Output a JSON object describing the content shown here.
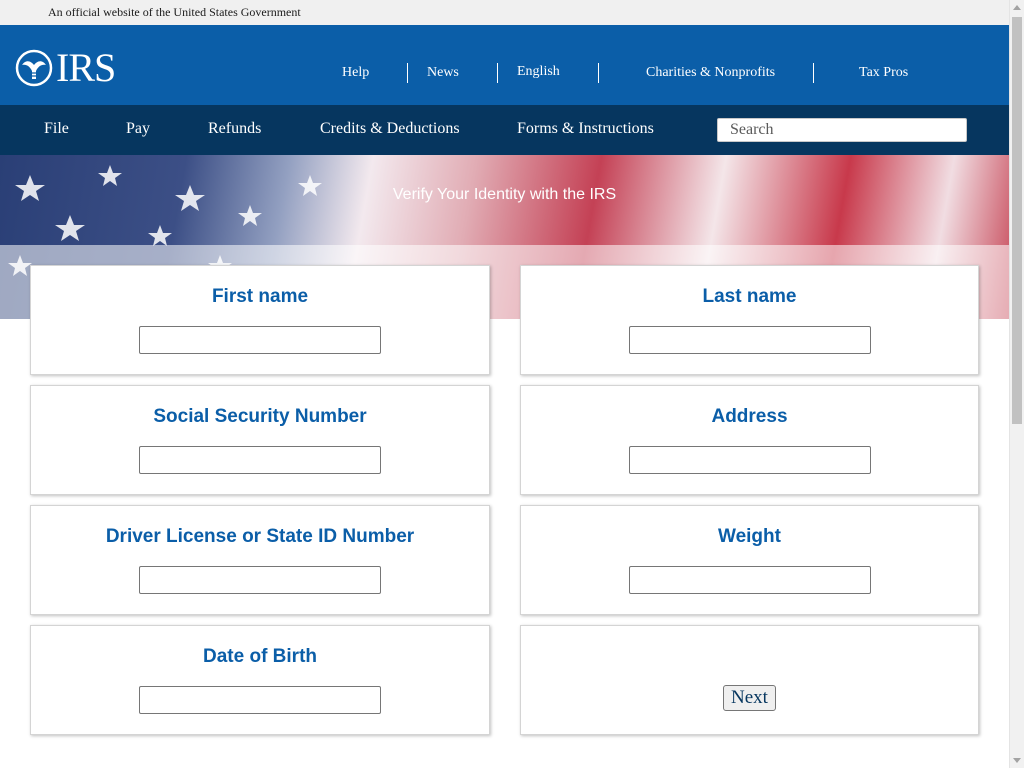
{
  "gov_banner": {
    "text": "An official website of the United States Government"
  },
  "header": {
    "logo_text": "IRS",
    "utility_links": [
      "Help",
      "News",
      "English",
      "Charities & Nonprofits",
      "Tax Pros"
    ]
  },
  "nav": {
    "items": [
      "File",
      "Pay",
      "Refunds",
      "Credits & Deductions",
      "Forms & Instructions"
    ],
    "search_placeholder": "Search"
  },
  "hero": {
    "title": "Verify Your Identity with the IRS"
  },
  "form": {
    "fields": [
      {
        "label": "First name",
        "value": ""
      },
      {
        "label": "Last name",
        "value": ""
      },
      {
        "label": "Social Security Number",
        "value": ""
      },
      {
        "label": "Address",
        "value": ""
      },
      {
        "label": "Driver License or State ID Number",
        "value": ""
      },
      {
        "label": "Weight",
        "value": ""
      },
      {
        "label": "Date of Birth",
        "value": ""
      }
    ],
    "next_label": "Next"
  },
  "colors": {
    "header_blue": "#0b5ea8",
    "nav_dark_blue": "#06365f",
    "label_blue": "#0b5ea8"
  }
}
